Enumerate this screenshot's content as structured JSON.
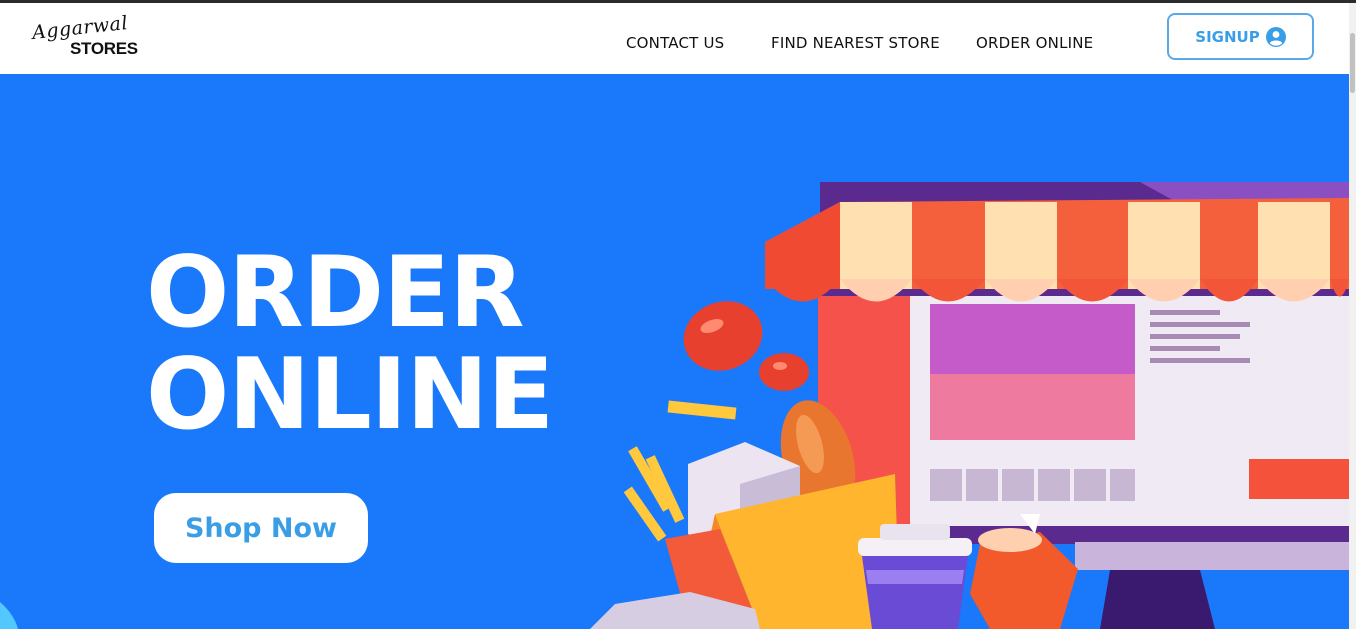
{
  "brand": {
    "script": "Aggarwal",
    "name": "STORES"
  },
  "nav": {
    "links": [
      "CONTACT US",
      "FIND NEAREST STORE",
      "ORDER ONLINE"
    ],
    "signup_label": "SIGNUP"
  },
  "hero": {
    "headline_line1": "ORDER",
    "headline_line2": "ONLINE",
    "cta_label": "Shop Now"
  },
  "colors": {
    "hero_bg": "#1a78fb",
    "accent": "#3a9ee6",
    "awning_red": "#f25b3a",
    "awning_cream": "#ffe0b0"
  },
  "icons": {
    "signup": "user-circle-icon"
  }
}
